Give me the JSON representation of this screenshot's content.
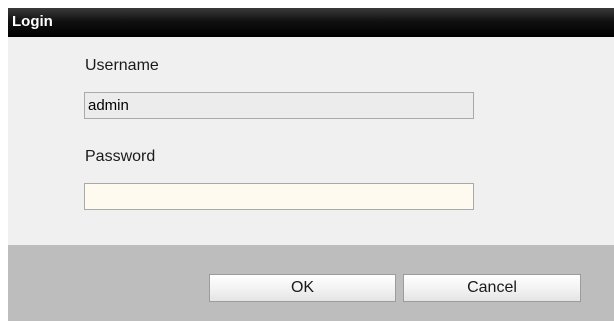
{
  "dialog": {
    "title": "Login"
  },
  "form": {
    "username_label": "Username",
    "username_value": "admin",
    "password_label": "Password",
    "password_value": ""
  },
  "buttons": {
    "ok_label": "OK",
    "cancel_label": "Cancel"
  },
  "colors": {
    "titlebar": "#000000",
    "body_background": "#f0f0f0",
    "footer_background": "#bdbdbd",
    "username_field_background": "#ececec",
    "password_field_background": "#fffaf0"
  }
}
